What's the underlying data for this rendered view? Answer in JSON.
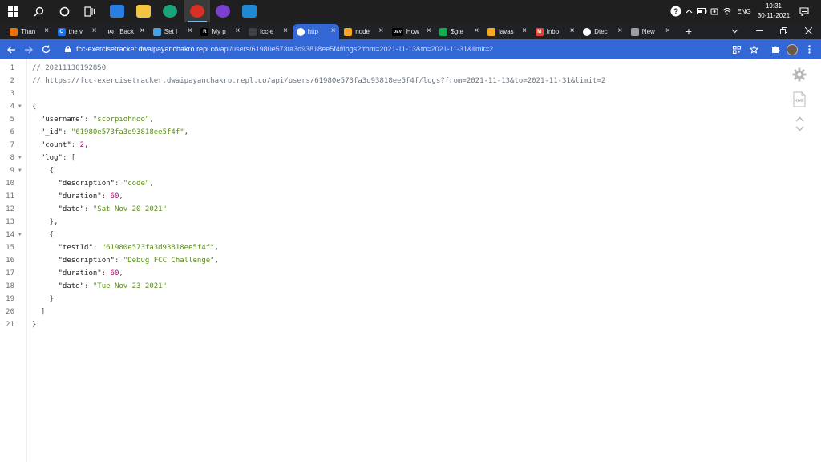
{
  "taskbar": {
    "search_icon": "magnifier-icon",
    "apps": [
      {
        "name": "mail-icon",
        "color": "#2a7de1"
      },
      {
        "name": "file-explorer-icon",
        "color": "#f4c542"
      },
      {
        "name": "edge-icon",
        "color": "#1aa37a"
      },
      {
        "name": "chrome-icon",
        "color": "#d93025"
      },
      {
        "name": "github-desktop-icon",
        "color": "#7b3fd1"
      },
      {
        "name": "vscode-icon",
        "color": "#1f8ad2"
      }
    ],
    "language": "ENG",
    "time": "19:31",
    "date": "30-11-2021"
  },
  "tabs": [
    {
      "title": "Than",
      "fav_color": "#e8710a",
      "fav_glyph": ""
    },
    {
      "title": "the v",
      "fav_color": "#1a73e8",
      "fav_glyph": "C"
    },
    {
      "title": "Back",
      "fav_color": "#202124",
      "fav_glyph": "(A)"
    },
    {
      "title": "Set I",
      "fav_color": "#4aa3df",
      "fav_glyph": ""
    },
    {
      "title": "My p",
      "fav_color": "#000000",
      "fav_glyph": "R"
    },
    {
      "title": "fcc-e",
      "fav_color": "#3c4043",
      "fav_glyph": ""
    },
    {
      "title": "http",
      "fav_color": "#ffffff",
      "fav_glyph": ""
    },
    {
      "title": "node",
      "fav_color": "#f9a825",
      "fav_glyph": ""
    },
    {
      "title": "How",
      "fav_color": "#000000",
      "fav_glyph": "DEV"
    },
    {
      "title": "$gte",
      "fav_color": "#13aa52",
      "fav_glyph": ""
    },
    {
      "title": "javas",
      "fav_color": "#f9a825",
      "fav_glyph": ""
    },
    {
      "title": "Inbo",
      "fav_color": "#ea4335",
      "fav_glyph": "M"
    },
    {
      "title": "Dtec",
      "fav_color": "#ffffff",
      "fav_glyph": ""
    },
    {
      "title": "New",
      "fav_color": "#9aa0a6",
      "fav_glyph": ""
    }
  ],
  "active_tab": 6,
  "address": {
    "host": "fcc-exercisetracker.dwaipayanchakro.repl.co",
    "path": "/api/users/61980e573fa3d93818ee5f4f/logs?from=2021-11-13&to=2021-11-31&limit=2"
  },
  "json_view": {
    "lines": [
      {
        "n": "1",
        "fold": "",
        "parts": [
          {
            "t": "// 20211130192850",
            "c": "cmt"
          }
        ]
      },
      {
        "n": "2",
        "fold": "",
        "parts": [
          {
            "t": "// https://fcc-exercisetracker.dwaipayanchakro.repl.co/api/users/61980e573fa3d93818ee5f4f/logs?from=2021-11-13&to=2021-11-31&limit=2",
            "c": "cmt"
          }
        ]
      },
      {
        "n": "3",
        "fold": "",
        "parts": []
      },
      {
        "n": "4",
        "fold": "▼",
        "parts": [
          {
            "t": "{",
            "c": "punc"
          }
        ]
      },
      {
        "n": "5",
        "fold": "",
        "parts": [
          {
            "t": "  \"username\"",
            "c": "key"
          },
          {
            "t": ": ",
            "c": "punc"
          },
          {
            "t": "\"scorpiohnoo\"",
            "c": "str"
          },
          {
            "t": ",",
            "c": "punc"
          }
        ]
      },
      {
        "n": "6",
        "fold": "",
        "parts": [
          {
            "t": "  \"_id\"",
            "c": "key"
          },
          {
            "t": ": ",
            "c": "punc"
          },
          {
            "t": "\"61980e573fa3d93818ee5f4f\"",
            "c": "str"
          },
          {
            "t": ",",
            "c": "punc"
          }
        ]
      },
      {
        "n": "7",
        "fold": "",
        "parts": [
          {
            "t": "  \"count\"",
            "c": "key"
          },
          {
            "t": ": ",
            "c": "punc"
          },
          {
            "t": "2",
            "c": "num"
          },
          {
            "t": ",",
            "c": "punc"
          }
        ]
      },
      {
        "n": "8",
        "fold": "▼",
        "parts": [
          {
            "t": "  \"log\"",
            "c": "key"
          },
          {
            "t": ": [",
            "c": "punc"
          }
        ]
      },
      {
        "n": "9",
        "fold": "▼",
        "parts": [
          {
            "t": "    {",
            "c": "punc"
          }
        ]
      },
      {
        "n": "10",
        "fold": "",
        "parts": [
          {
            "t": "      \"description\"",
            "c": "key"
          },
          {
            "t": ": ",
            "c": "punc"
          },
          {
            "t": "\"code\"",
            "c": "str"
          },
          {
            "t": ",",
            "c": "punc"
          }
        ]
      },
      {
        "n": "11",
        "fold": "",
        "parts": [
          {
            "t": "      \"duration\"",
            "c": "key"
          },
          {
            "t": ": ",
            "c": "punc"
          },
          {
            "t": "60",
            "c": "num"
          },
          {
            "t": ",",
            "c": "punc"
          }
        ]
      },
      {
        "n": "12",
        "fold": "",
        "parts": [
          {
            "t": "      \"date\"",
            "c": "key"
          },
          {
            "t": ": ",
            "c": "punc"
          },
          {
            "t": "\"Sat Nov 20 2021\"",
            "c": "str"
          }
        ]
      },
      {
        "n": "13",
        "fold": "",
        "parts": [
          {
            "t": "    },",
            "c": "punc"
          }
        ]
      },
      {
        "n": "14",
        "fold": "▼",
        "parts": [
          {
            "t": "    {",
            "c": "punc"
          }
        ]
      },
      {
        "n": "15",
        "fold": "",
        "parts": [
          {
            "t": "      \"testId\"",
            "c": "key"
          },
          {
            "t": ": ",
            "c": "punc"
          },
          {
            "t": "\"61980e573fa3d93818ee5f4f\"",
            "c": "str"
          },
          {
            "t": ",",
            "c": "punc"
          }
        ]
      },
      {
        "n": "16",
        "fold": "",
        "parts": [
          {
            "t": "      \"description\"",
            "c": "key"
          },
          {
            "t": ": ",
            "c": "punc"
          },
          {
            "t": "\"Debug FCC Challenge\"",
            "c": "str"
          },
          {
            "t": ",",
            "c": "punc"
          }
        ]
      },
      {
        "n": "17",
        "fold": "",
        "parts": [
          {
            "t": "      \"duration\"",
            "c": "key"
          },
          {
            "t": ": ",
            "c": "punc"
          },
          {
            "t": "60",
            "c": "num"
          },
          {
            "t": ",",
            "c": "punc"
          }
        ]
      },
      {
        "n": "18",
        "fold": "",
        "parts": [
          {
            "t": "      \"date\"",
            "c": "key"
          },
          {
            "t": ": ",
            "c": "punc"
          },
          {
            "t": "\"Tue Nov 23 2021\"",
            "c": "str"
          }
        ]
      },
      {
        "n": "19",
        "fold": "",
        "parts": [
          {
            "t": "    }",
            "c": "punc"
          }
        ]
      },
      {
        "n": "20",
        "fold": "",
        "parts": [
          {
            "t": "  ]",
            "c": "punc"
          }
        ]
      },
      {
        "n": "21",
        "fold": "",
        "parts": [
          {
            "t": "}",
            "c": "punc"
          }
        ]
      }
    ]
  },
  "side_tools": {
    "raw_label": "RAW"
  }
}
